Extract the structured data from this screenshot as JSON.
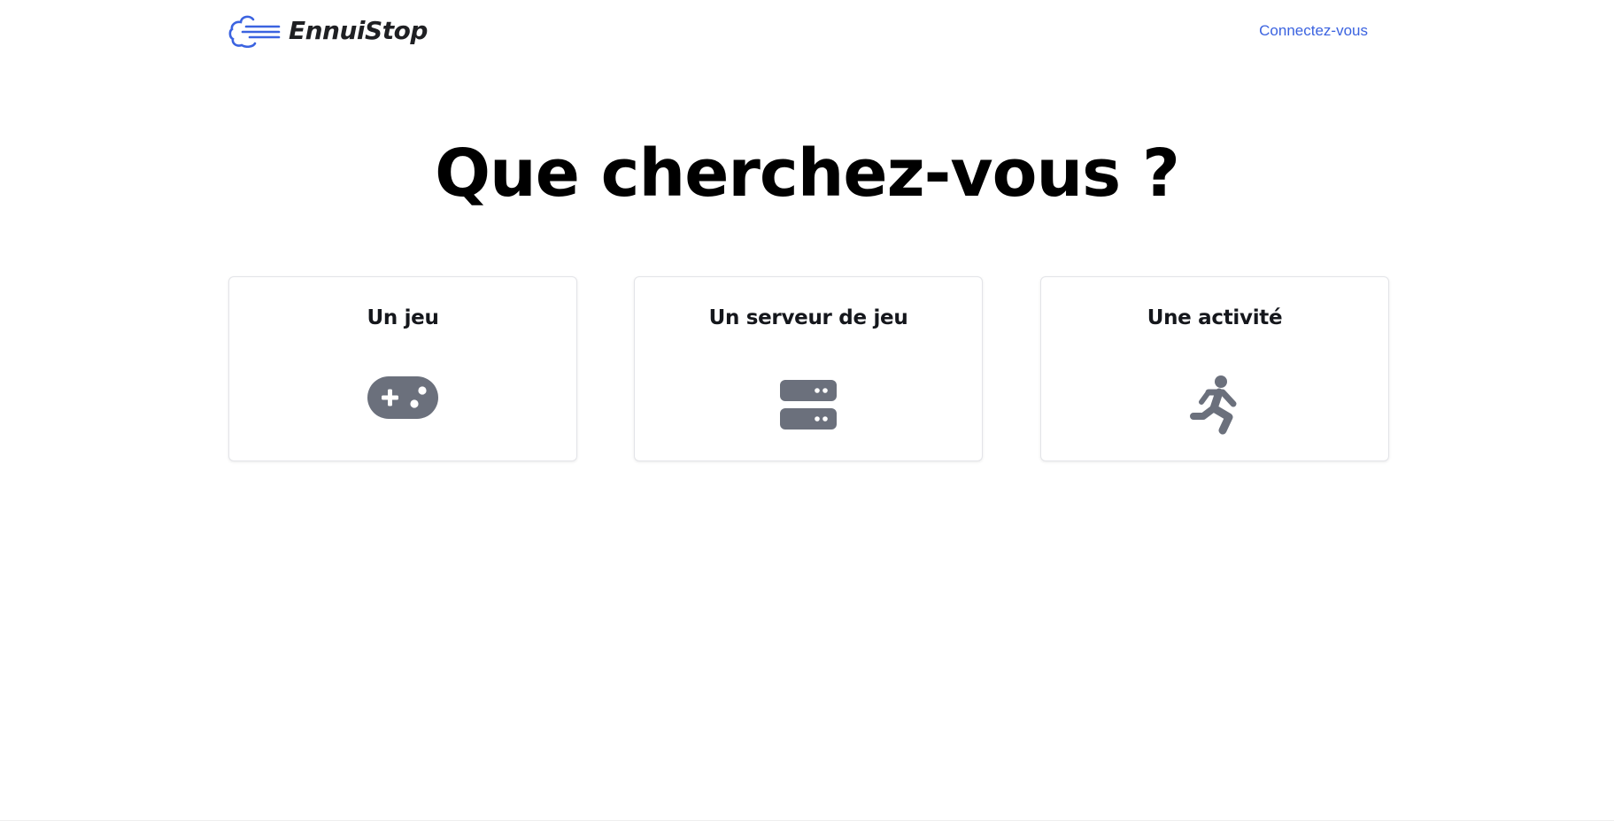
{
  "header": {
    "brand_name": "EnnuiStop",
    "login_label": "Connectez-vous",
    "logo_icon": "wind-cloud-icon",
    "accent_color": "#3b63e0"
  },
  "main": {
    "title": "Que cherchez-vous ?",
    "cards": [
      {
        "label": "Un jeu",
        "icon": "gamepad-icon"
      },
      {
        "label": "Un serveur de jeu",
        "icon": "server-icon"
      },
      {
        "label": "Une activité",
        "icon": "running-person-icon"
      }
    ],
    "icon_color": "#6b707c"
  }
}
